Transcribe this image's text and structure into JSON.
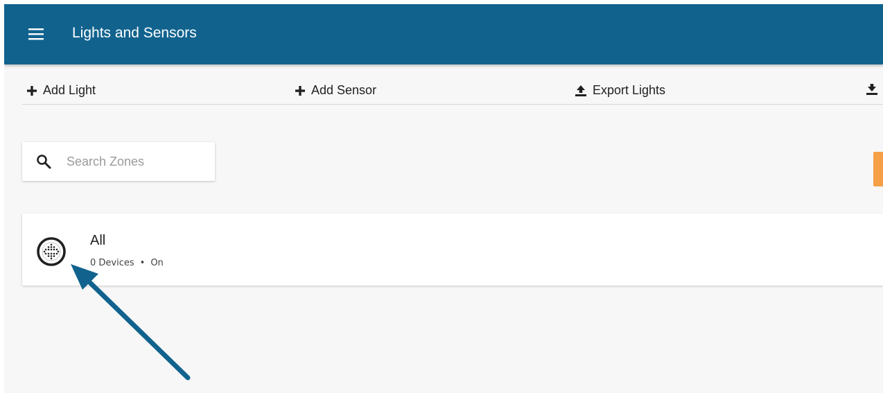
{
  "app_bar": {
    "title": "Lights and Sensors"
  },
  "toolbar": {
    "add_light": "Add Light",
    "add_sensor": "Add Sensor",
    "export_lights": "Export Lights"
  },
  "search": {
    "placeholder": "Search Zones"
  },
  "zone": {
    "name": "All",
    "devices": "0 Devices",
    "separator": "•",
    "status": "On"
  },
  "colors": {
    "app_bar": "#11638e",
    "annotation_arrow": "#11638e",
    "accent_tab": "#f5a047",
    "background": "#f7f7f7"
  },
  "icons": {
    "menu": "menu-icon",
    "add": "plus-icon",
    "export": "upload-icon",
    "import": "download-icon",
    "search": "search-icon",
    "zone": "zone-grid-icon"
  }
}
